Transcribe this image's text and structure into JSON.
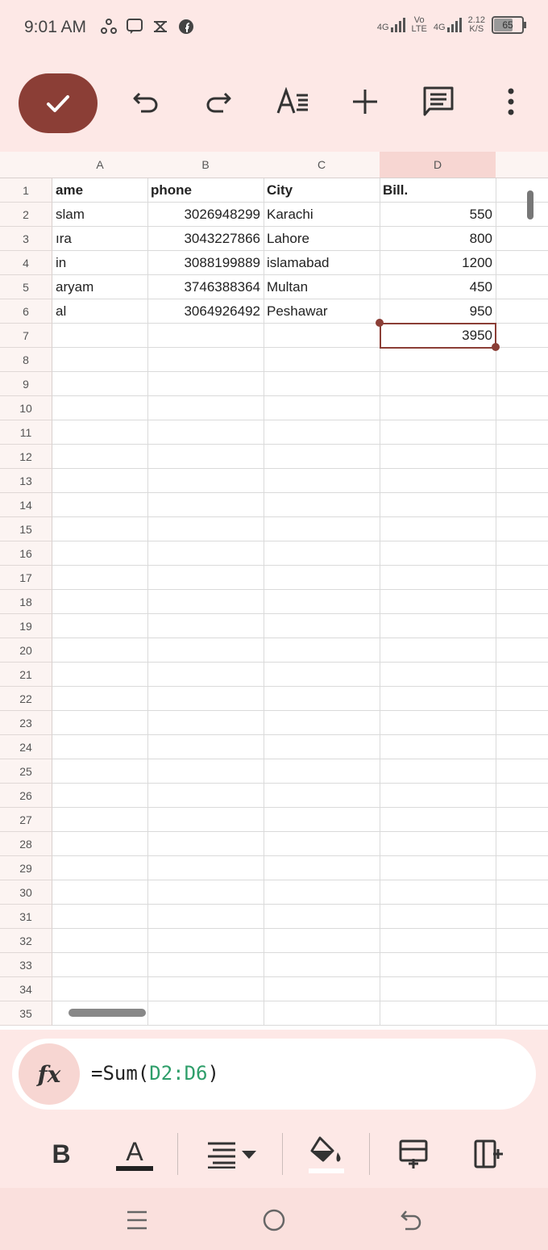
{
  "status_bar": {
    "time": "9:01 AM",
    "network_1": "4G",
    "volte_top": "Vo",
    "volte_bottom": "LTE",
    "network_2": "4G",
    "speed_value": "2.12",
    "speed_unit": "K/S",
    "battery": "65"
  },
  "toolbar": {
    "icons": [
      "check-icon",
      "undo-icon",
      "redo-icon",
      "text-format-icon",
      "add-icon",
      "comment-icon",
      "more-vert-icon"
    ]
  },
  "sheet": {
    "columns": [
      "A",
      "B",
      "C",
      "D"
    ],
    "selected_column": "D",
    "rows": [
      {
        "num": "1",
        "cells": [
          "ame",
          "phone",
          "City",
          "Bill."
        ]
      },
      {
        "num": "2",
        "cells": [
          "slam",
          "3026948299",
          "Karachi",
          "550"
        ]
      },
      {
        "num": "3",
        "cells": [
          "ıra",
          "3043227866",
          "Lahore",
          "800"
        ]
      },
      {
        "num": "4",
        "cells": [
          "in",
          "3088199889",
          "islamabad",
          "1200"
        ]
      },
      {
        "num": "5",
        "cells": [
          "aryam",
          "3746388364",
          "Multan",
          "450"
        ]
      },
      {
        "num": "6",
        "cells": [
          "al",
          "3064926492",
          "Peshawar",
          "950"
        ]
      },
      {
        "num": "7",
        "cells": [
          "",
          "",
          "",
          "3950"
        ]
      },
      {
        "num": "8",
        "cells": [
          "",
          "",
          "",
          ""
        ]
      },
      {
        "num": "9",
        "cells": [
          "",
          "",
          "",
          ""
        ]
      },
      {
        "num": "10",
        "cells": [
          "",
          "",
          "",
          ""
        ]
      },
      {
        "num": "11",
        "cells": [
          "",
          "",
          "",
          ""
        ]
      },
      {
        "num": "12",
        "cells": [
          "",
          "",
          "",
          ""
        ]
      },
      {
        "num": "13",
        "cells": [
          "",
          "",
          "",
          ""
        ]
      },
      {
        "num": "14",
        "cells": [
          "",
          "",
          "",
          ""
        ]
      },
      {
        "num": "15",
        "cells": [
          "",
          "",
          "",
          ""
        ]
      },
      {
        "num": "16",
        "cells": [
          "",
          "",
          "",
          ""
        ]
      },
      {
        "num": "17",
        "cells": [
          "",
          "",
          "",
          ""
        ]
      },
      {
        "num": "18",
        "cells": [
          "",
          "",
          "",
          ""
        ]
      },
      {
        "num": "19",
        "cells": [
          "",
          "",
          "",
          ""
        ]
      },
      {
        "num": "20",
        "cells": [
          "",
          "",
          "",
          ""
        ]
      },
      {
        "num": "21",
        "cells": [
          "",
          "",
          "",
          ""
        ]
      },
      {
        "num": "22",
        "cells": [
          "",
          "",
          "",
          ""
        ]
      },
      {
        "num": "23",
        "cells": [
          "",
          "",
          "",
          ""
        ]
      },
      {
        "num": "24",
        "cells": [
          "",
          "",
          "",
          ""
        ]
      },
      {
        "num": "25",
        "cells": [
          "",
          "",
          "",
          ""
        ]
      },
      {
        "num": "26",
        "cells": [
          "",
          "",
          "",
          ""
        ]
      },
      {
        "num": "27",
        "cells": [
          "",
          "",
          "",
          ""
        ]
      },
      {
        "num": "28",
        "cells": [
          "",
          "",
          "",
          ""
        ]
      },
      {
        "num": "29",
        "cells": [
          "",
          "",
          "",
          ""
        ]
      },
      {
        "num": "30",
        "cells": [
          "",
          "",
          "",
          ""
        ]
      },
      {
        "num": "31",
        "cells": [
          "",
          "",
          "",
          ""
        ]
      },
      {
        "num": "32",
        "cells": [
          "",
          "",
          "",
          ""
        ]
      },
      {
        "num": "33",
        "cells": [
          "",
          "",
          "",
          ""
        ]
      },
      {
        "num": "34",
        "cells": [
          "",
          "",
          "",
          ""
        ]
      },
      {
        "num": "35",
        "cells": [
          "",
          "",
          "",
          ""
        ]
      }
    ],
    "selected_cell": "D7"
  },
  "formula_bar": {
    "fx_label": "fx",
    "prefix": "=Sum(",
    "range": "D2:D6",
    "suffix": ")"
  },
  "format_bar": {
    "bold_label": "B",
    "text_color_label": "A"
  },
  "colors": {
    "accent": "#8b3e36",
    "background": "#fde8e6",
    "selected_header": "#f7d6d2",
    "formula_ref": "#2e9e6a"
  }
}
